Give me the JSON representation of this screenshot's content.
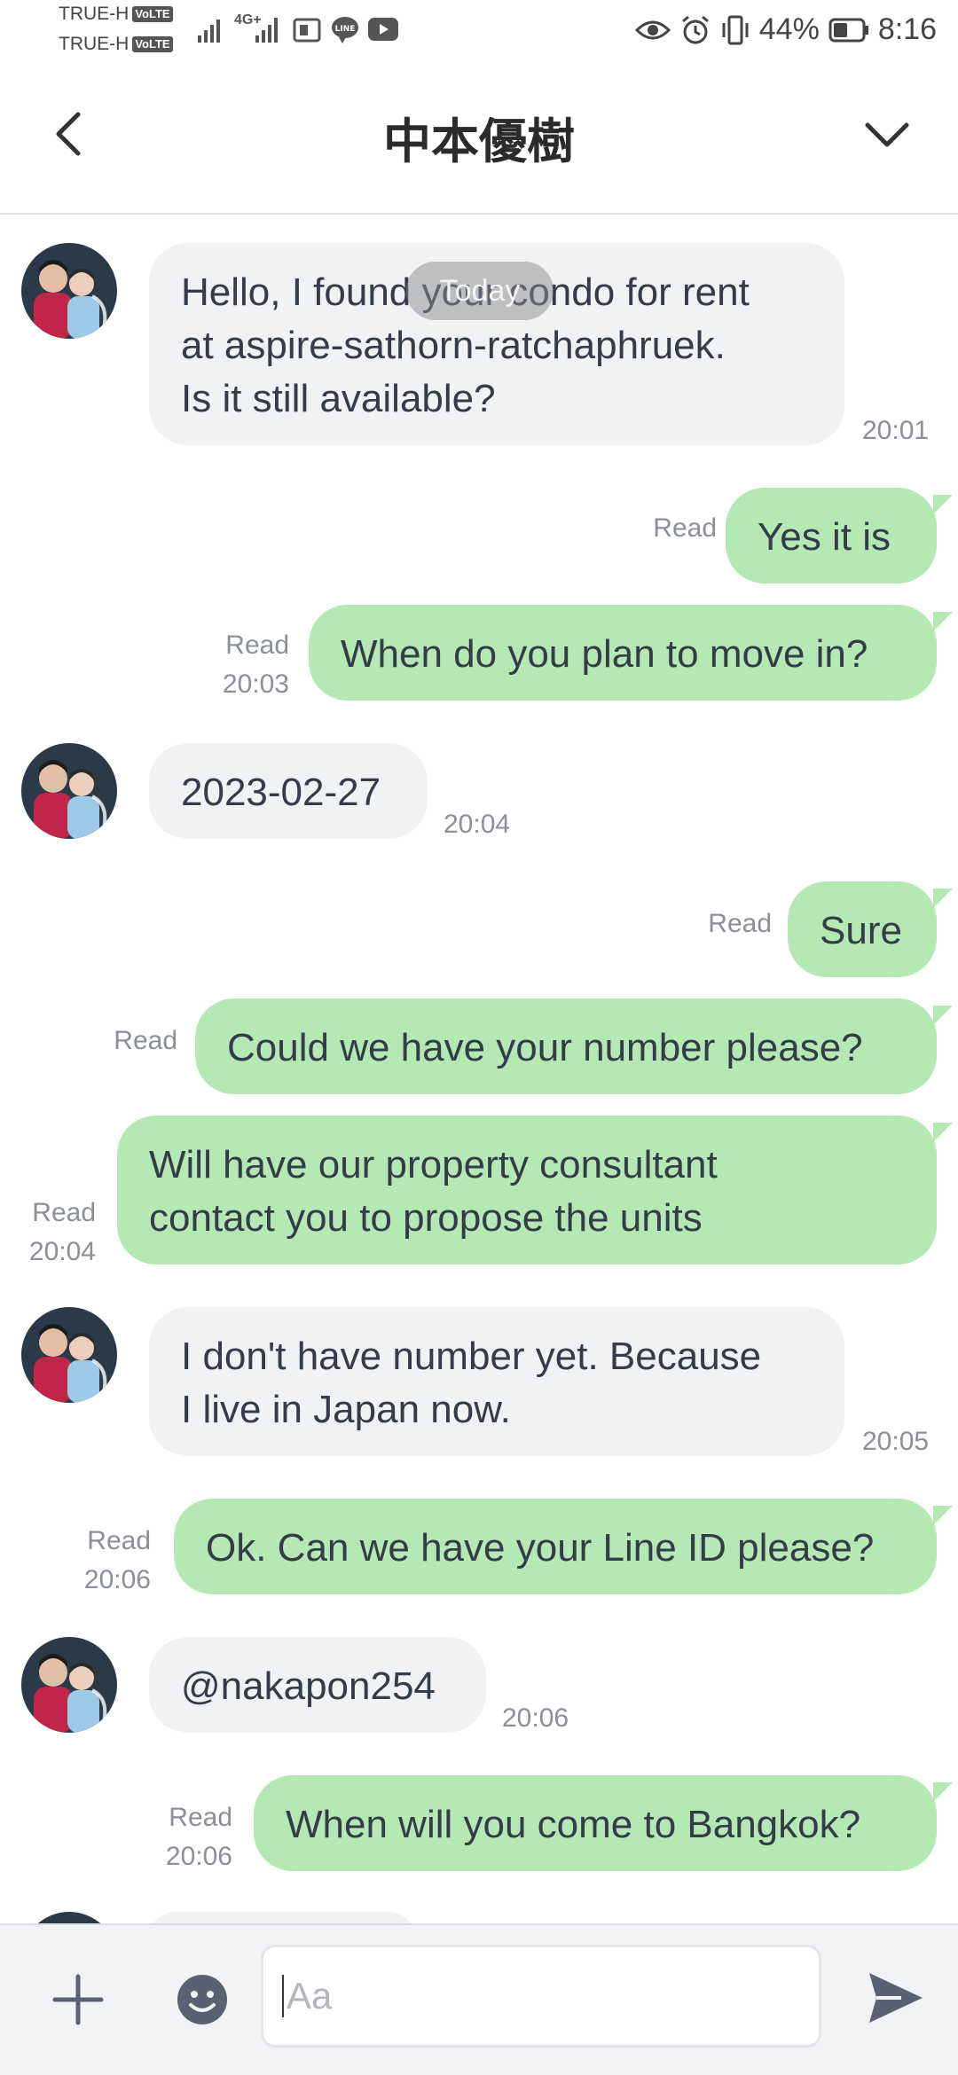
{
  "status_bar": {
    "carrier1": "TRUE-H",
    "carrier2": "TRUE-H",
    "volte_badge": "VoLTE",
    "network": "4G+",
    "battery": "44%",
    "time": "8:16"
  },
  "header": {
    "title": "中本優樹"
  },
  "chat": {
    "date_pill": "Today",
    "messages": [
      {
        "sender": "other",
        "text": "Hello, I found your condo for rent at aspire-sathorn-ratchaphruek. Is it still available?",
        "lines": [
          "Hello, I found your condo for rent",
          "at aspire-sathorn-ratchaphruek.",
          "Is it still available?"
        ],
        "time": "20:01"
      },
      {
        "sender": "me",
        "text": "Yes it is",
        "read": "Read",
        "time": ""
      },
      {
        "sender": "me",
        "text": "When do you plan to move in?",
        "read": "Read",
        "time": "20:03"
      },
      {
        "sender": "other",
        "text": "2023-02-27",
        "time": "20:04"
      },
      {
        "sender": "me",
        "text": "Sure",
        "read": "Read",
        "time": ""
      },
      {
        "sender": "me",
        "text": "Could we have your number please?",
        "read": "Read",
        "time": ""
      },
      {
        "sender": "me",
        "text": "Will have our property consultant contact you to propose the units",
        "lines": [
          "Will have our property consultant",
          "contact you to propose the units"
        ],
        "read": "Read",
        "time": "20:04"
      },
      {
        "sender": "other",
        "text": "I don't have number yet. Because I live in Japan now.",
        "lines": [
          "I don't have number yet. Because",
          "I live in Japan now."
        ],
        "time": "20:05"
      },
      {
        "sender": "me",
        "text": "Ok. Can we have your Line ID please?",
        "read": "Read",
        "time": "20:06"
      },
      {
        "sender": "other",
        "text": "@nakapon254",
        "time": "20:06"
      },
      {
        "sender": "me",
        "text": "When will you come to Bangkok?",
        "read": "Read",
        "time": "20:06"
      }
    ]
  },
  "input_bar": {
    "placeholder": "Aa"
  },
  "colors": {
    "outgoing_bubble": "#b6e8b3",
    "incoming_bubble": "#f1f2f4",
    "text": "#333c48",
    "meta": "#8b9096",
    "send_icon": "#5a6170"
  }
}
